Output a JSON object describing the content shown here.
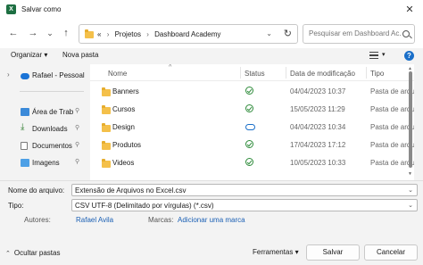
{
  "window": {
    "title": "Salvar como",
    "app_icon_letter": "X",
    "close": "✕"
  },
  "nav": {
    "back": "←",
    "forward": "→",
    "dropdown": "⌄",
    "up": "↑",
    "crumb_prefix": "«",
    "crumbs": [
      "Projetos",
      "Dashboard Academy"
    ],
    "crumb_sep": "›",
    "refresh": "↻",
    "addr_chevron": "⌄",
    "search_placeholder": "Pesquisar em Dashboard Ac..."
  },
  "toolbar": {
    "organize": "Organizar ▾",
    "new_folder": "Nova pasta"
  },
  "sidebar": {
    "items": [
      {
        "label": "Rafael - Pessoal",
        "icon": "cloud-icon"
      },
      {
        "label": "Área de Trab",
        "icon": "desktop-icon"
      },
      {
        "label": "Downloads",
        "icon": "download-icon"
      },
      {
        "label": "Documentos",
        "icon": "documents-icon"
      },
      {
        "label": "Imagens",
        "icon": "images-icon"
      }
    ]
  },
  "columns": {
    "name": "Nome",
    "status": "Status",
    "modified": "Data de modificação",
    "type": "Tipo"
  },
  "files": [
    {
      "name": "Banners",
      "status": "synced",
      "modified": "04/04/2023 10:37",
      "type": "Pasta de arqui"
    },
    {
      "name": "Cursos",
      "status": "synced",
      "modified": "15/05/2023 11:29",
      "type": "Pasta de arqui"
    },
    {
      "name": "Design",
      "status": "cloud",
      "modified": "04/04/2023 10:34",
      "type": "Pasta de arqui"
    },
    {
      "name": "Produtos",
      "status": "synced",
      "modified": "17/04/2023 17:12",
      "type": "Pasta de arqui"
    },
    {
      "name": "Videos",
      "status": "synced",
      "modified": "10/05/2023 10:33",
      "type": "Pasta de arqui"
    }
  ],
  "form": {
    "filename_label": "Nome do arquivo:",
    "filename_value": "Extensão de Arquivos no Excel.csv",
    "type_label": "Tipo:",
    "type_value": "CSV UTF-8 (Delimitado por vírgulas) (*.csv)",
    "authors_label": "Autores:",
    "authors_value": "Rafael Avila",
    "tags_link": "Adicionar uma marca"
  },
  "footer": {
    "hide_folders": "Ocultar pastas",
    "tools": "Ferramentas ▾",
    "save": "Salvar",
    "cancel": "Cancelar"
  },
  "colors": {
    "accent": "#1a6fc9",
    "excel_green": "#1d6f42",
    "folder": "#f4c04a",
    "synced": "#2e8b3a"
  }
}
